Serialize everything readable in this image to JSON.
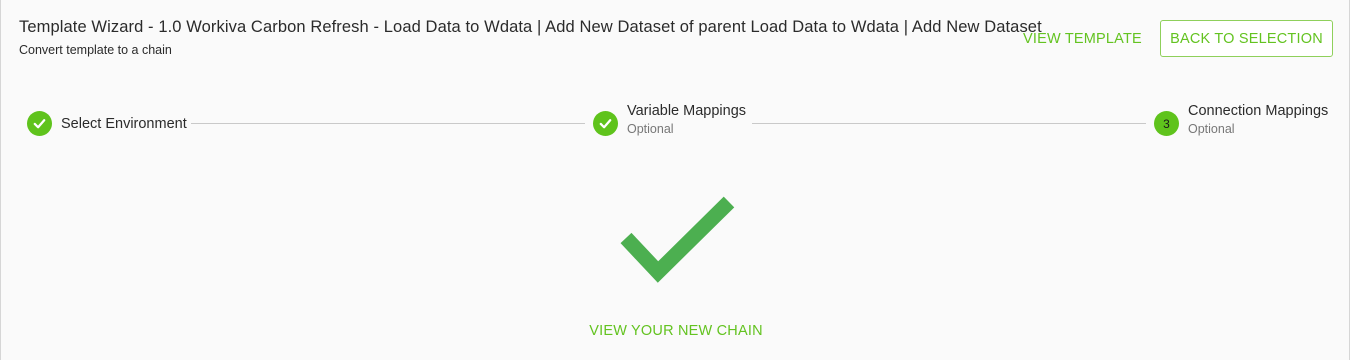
{
  "header": {
    "title": "Template Wizard - 1.0 Workiva Carbon Refresh - Load Data to Wdata | Add New Dataset of parent Load Data to Wdata | Add New Dataset",
    "subtitle": "Convert template to a chain"
  },
  "actions": {
    "view_template": "VIEW TEMPLATE",
    "back_to_selection": "BACK TO SELECTION"
  },
  "stepper": {
    "steps": [
      {
        "label": "Select Environment",
        "sub": "",
        "status": "complete"
      },
      {
        "label": "Variable Mappings",
        "sub": "Optional",
        "status": "complete"
      },
      {
        "label": "Connection Mappings",
        "sub": "Optional",
        "status": "current",
        "number": "3"
      }
    ]
  },
  "result": {
    "icon": "checkmark-icon",
    "link": "VIEW YOUR NEW CHAIN"
  },
  "colors": {
    "accent": "#63c320",
    "success": "#4caf50"
  }
}
